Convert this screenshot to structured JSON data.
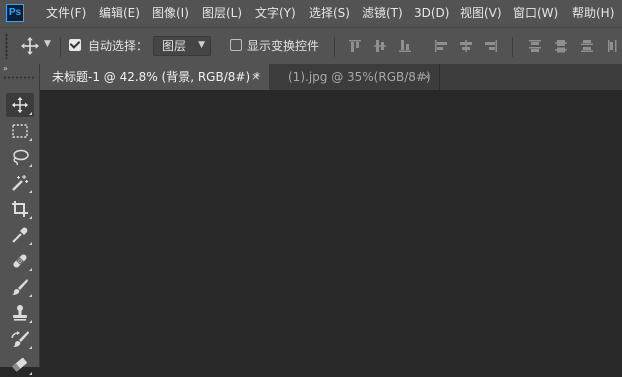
{
  "app": {
    "logo": "Ps"
  },
  "menu": [
    "文件(F)",
    "编辑(E)",
    "图像(I)",
    "图层(L)",
    "文字(Y)",
    "选择(S)",
    "滤镜(T)",
    "3D(D)",
    "视图(V)",
    "窗口(W)",
    "帮助(H)"
  ],
  "options": {
    "auto_select_label": "自动选择：",
    "auto_select_checked": true,
    "layer_select_value": "图层",
    "show_transform_label": "显示变换控件",
    "show_transform_checked": false
  },
  "tabs": [
    {
      "title": "未标题-1 @ 42.8% (背景, RGB/8#) *",
      "active": true,
      "close": "×"
    },
    {
      "title": "(1).jpg @ 35%(RGB/8#)",
      "active": false,
      "close": "×"
    }
  ],
  "panel": {
    "collapse_glyph": "»"
  },
  "tools": [
    "move-tool",
    "marquee-tool",
    "lasso-tool",
    "magic-wand-tool",
    "crop-tool",
    "eyedropper-tool",
    "healing-brush-tool",
    "brush-tool",
    "clone-stamp-tool",
    "history-brush-tool",
    "eraser-tool"
  ],
  "colors": {
    "chrome": "#535353",
    "canvas": "#282828",
    "tabstrip": "#3c3c3c",
    "accent": "#31a8ff"
  }
}
